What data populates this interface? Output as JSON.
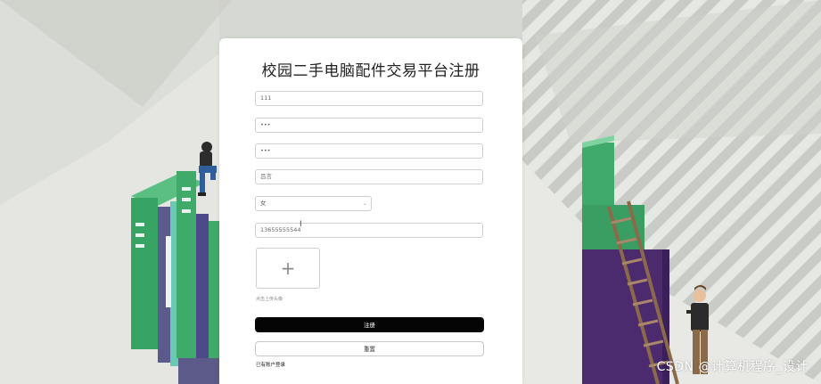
{
  "page": {
    "title": "校园二手电脑配件交易平台注册",
    "watermark": "CSDN @计算机程序_设计"
  },
  "form": {
    "account_value": "111",
    "password_value": "•••",
    "confirm_password_value": "•••",
    "name_value": "吕言",
    "gender_selected": "女",
    "phone_value": "13655555544",
    "upload_hint": "点击上传头像",
    "register_label": "注册",
    "reset_label": "重置",
    "login_link": "已有账户登录"
  },
  "colors": {
    "primary_button": "#050505",
    "card_bg": "#ffffff",
    "book_green": "#3faa6a",
    "book_purple": "#4b2a6e"
  }
}
